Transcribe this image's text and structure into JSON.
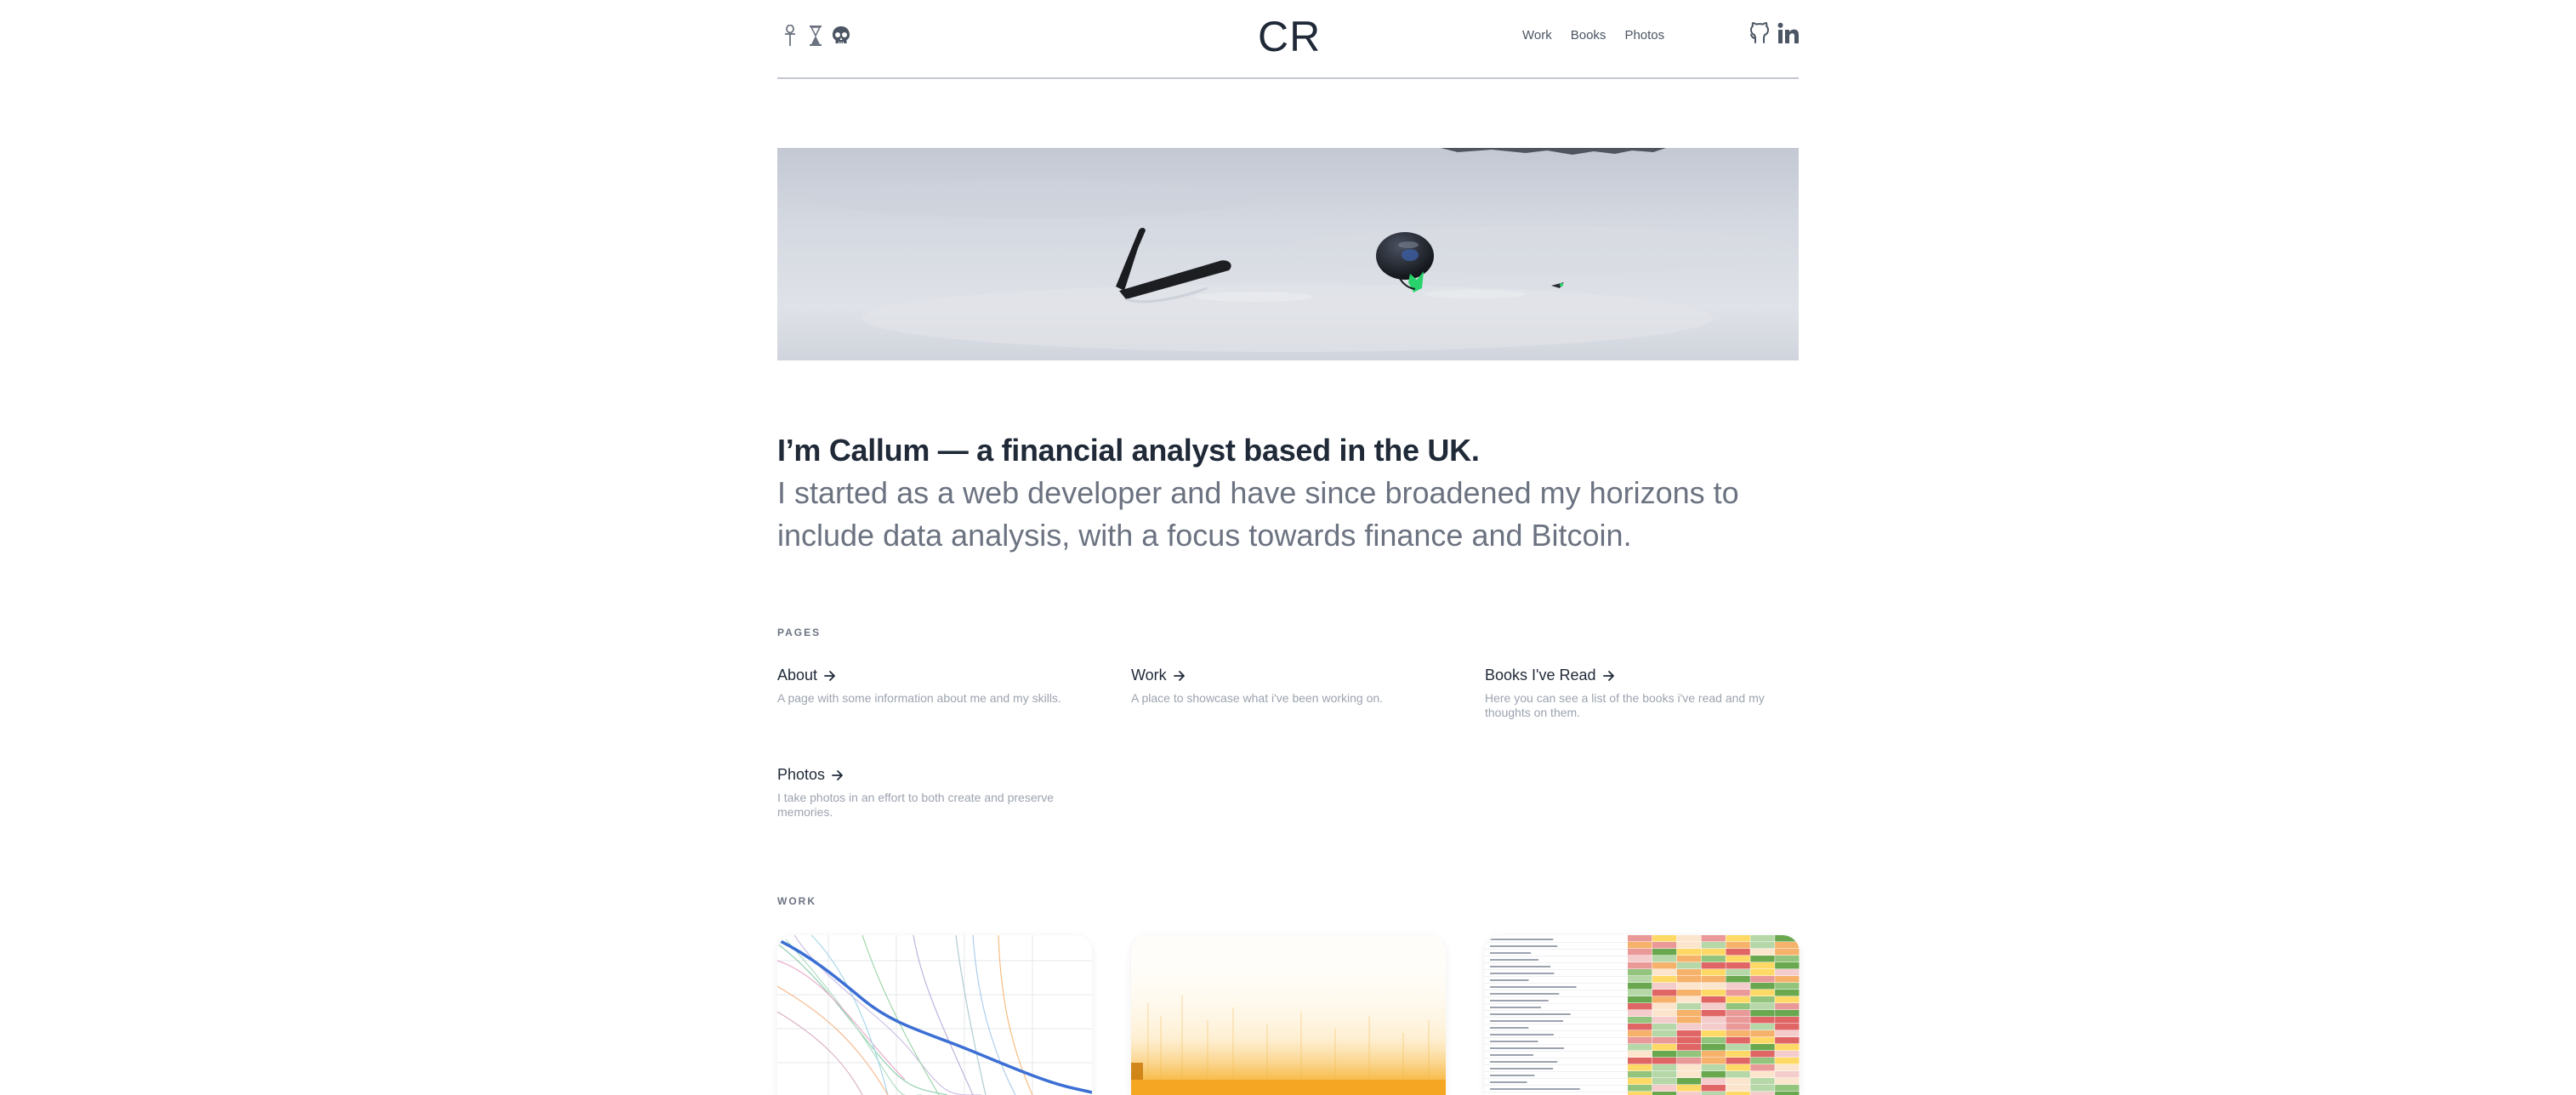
{
  "header": {
    "logo": "CR",
    "icons_left": [
      "ankh-icon",
      "hourglass-icon",
      "skull-icon"
    ],
    "nav": [
      "Work",
      "Books",
      "Photos"
    ],
    "social": [
      "github-icon",
      "linkedin-icon"
    ]
  },
  "intro": {
    "heading": "I’m Callum — a financial analyst based in the UK.",
    "body": "I started as a web developer and have since broadened my horizons to include data analysis, with a focus towards finance and Bitcoin."
  },
  "pages_section": {
    "label": "PAGES",
    "items": [
      {
        "title": "About",
        "desc": "A page with some information about me and my skills."
      },
      {
        "title": "Work",
        "desc": "A place to showcase what i've been working on."
      },
      {
        "title": "Books I've Read",
        "desc": "Here you can see a list of the books i've read and my thoughts on them."
      },
      {
        "title": "Photos",
        "desc": "I take photos in an effort to both create and preserve memories."
      }
    ]
  },
  "work_section": {
    "label": "WORK"
  },
  "colors": {
    "text_primary": "#1f2937",
    "text_secondary": "#6b7280",
    "text_muted": "#9ca3af",
    "accent_blue": "#3b6fd4",
    "accent_orange": "#f5a623"
  }
}
